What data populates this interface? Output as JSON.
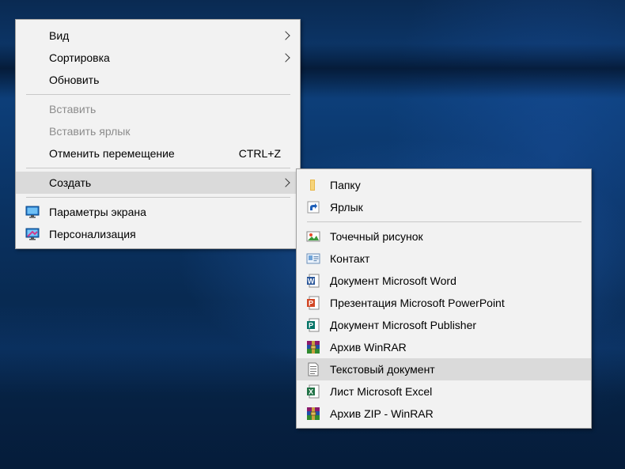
{
  "main_menu": {
    "items": [
      {
        "label": "Вид"
      },
      {
        "label": "Сортировка"
      },
      {
        "label": "Обновить"
      },
      {
        "label": "Вставить"
      },
      {
        "label": "Вставить ярлык"
      },
      {
        "label": "Отменить перемещение",
        "shortcut": "CTRL+Z"
      },
      {
        "label": "Создать"
      },
      {
        "label": "Параметры экрана",
        "icon": "display-settings-icon"
      },
      {
        "label": "Персонализация",
        "icon": "personalization-icon"
      }
    ]
  },
  "sub_menu": {
    "items": [
      {
        "label": "Папку",
        "icon": "folder-icon"
      },
      {
        "label": "Ярлык",
        "icon": "shortcut-icon"
      },
      {
        "label": "Точечный рисунок",
        "icon": "bitmap-icon"
      },
      {
        "label": "Контакт",
        "icon": "contact-icon"
      },
      {
        "label": "Документ Microsoft Word",
        "icon": "word-icon"
      },
      {
        "label": "Презентация Microsoft PowerPoint",
        "icon": "powerpoint-icon"
      },
      {
        "label": "Документ Microsoft Publisher",
        "icon": "publisher-icon"
      },
      {
        "label": "Архив WinRAR",
        "icon": "winrar-icon"
      },
      {
        "label": "Текстовый документ",
        "icon": "text-document-icon"
      },
      {
        "label": "Лист Microsoft Excel",
        "icon": "excel-icon"
      },
      {
        "label": "Архив ZIP - WinRAR",
        "icon": "winrar-zip-icon"
      }
    ]
  },
  "colors": {
    "menu_bg": "#f2f2f2",
    "highlight": "#dadada",
    "disabled_text": "#8c8c8c",
    "desktop": "#0d3f7a"
  }
}
